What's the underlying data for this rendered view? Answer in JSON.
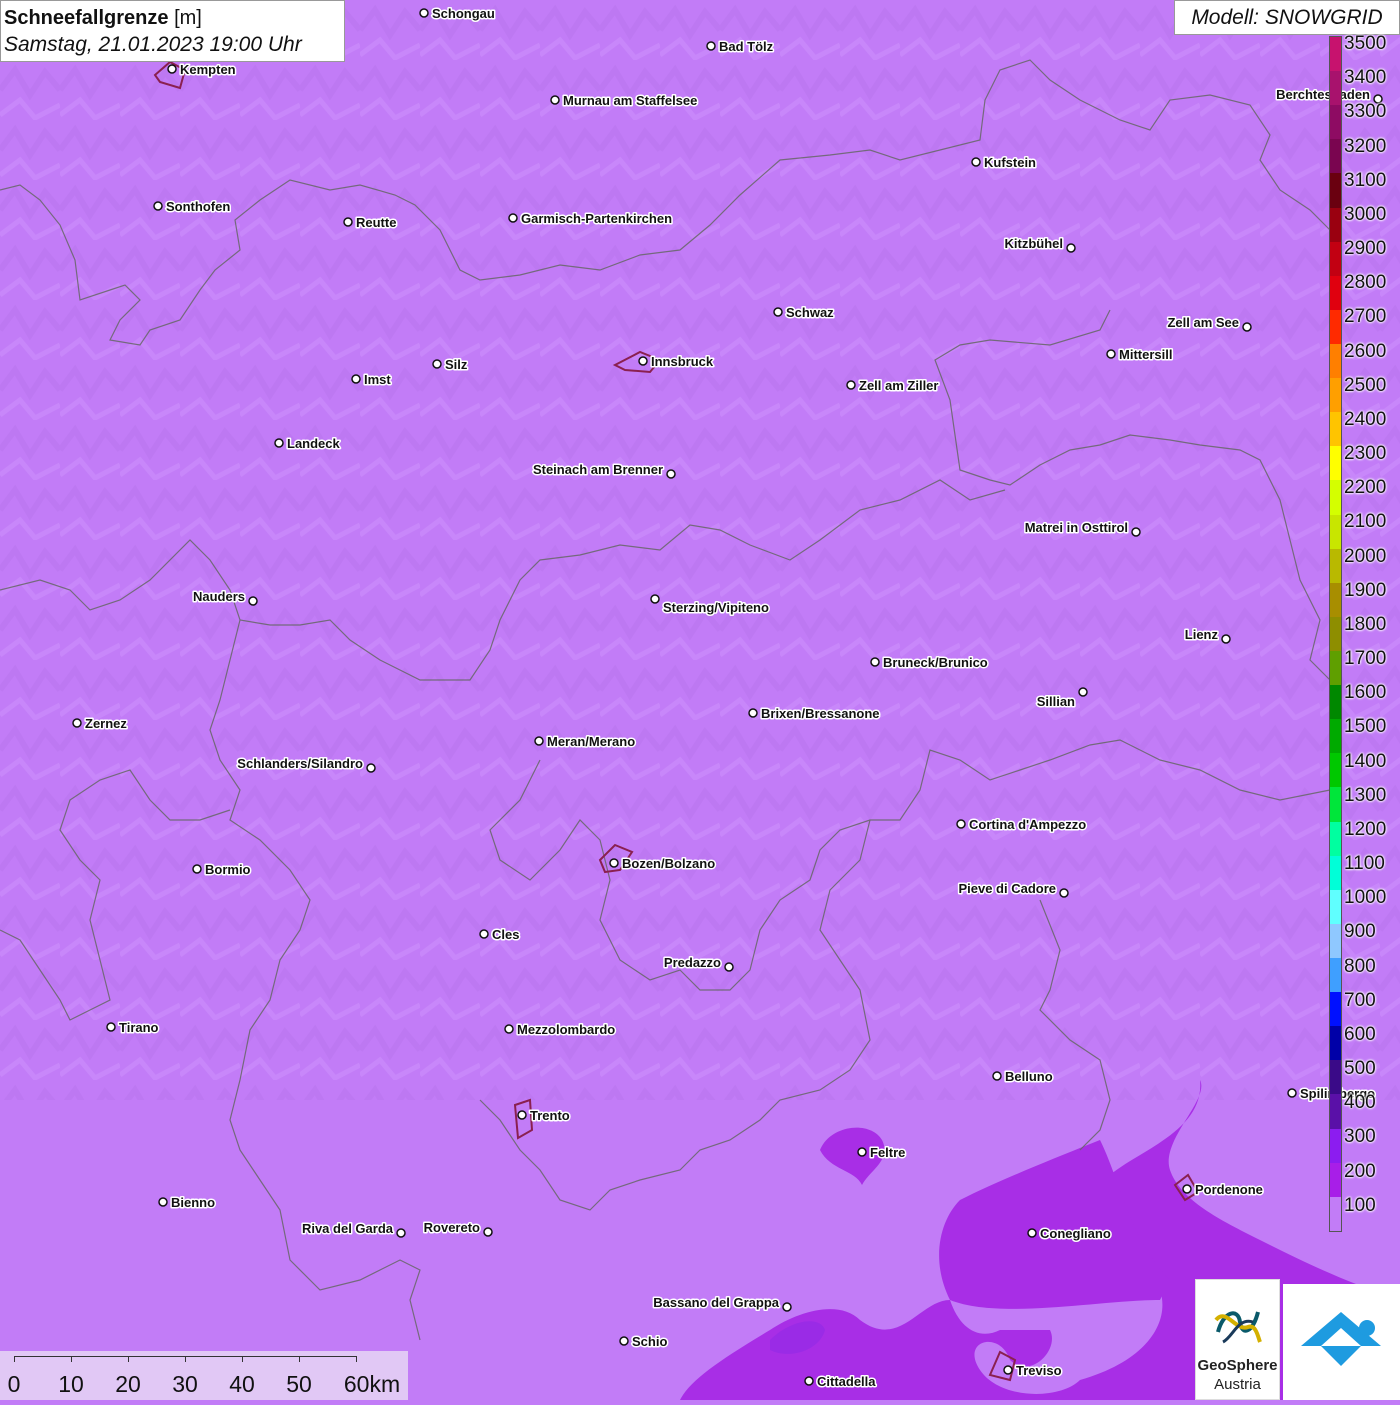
{
  "title": {
    "variable": "Schneefallgrenze",
    "unit": "[m]",
    "datetime": "Samstag, 21.01.2023 19:00 Uhr"
  },
  "model": "Modell: SNOWGRID",
  "legend": {
    "labels": [
      "3500",
      "3400",
      "3300",
      "3200",
      "3100",
      "3000",
      "2900",
      "2800",
      "2700",
      "2600",
      "2500",
      "2400",
      "2300",
      "2200",
      "2100",
      "2000",
      "1900",
      "1800",
      "1700",
      "1600",
      "1500",
      "1400",
      "1300",
      "1200",
      "1100",
      "1000",
      "900",
      "800",
      "700",
      "600",
      "500",
      "400",
      "300",
      "200",
      "100"
    ],
    "colors": [
      "#c7126e",
      "#a8126d",
      "#8e0b63",
      "#7a0550",
      "#6a0010",
      "#9a0010",
      "#c20012",
      "#e0000f",
      "#ff2a00",
      "#ff7f00",
      "#ff9f00",
      "#ffc400",
      "#ffff00",
      "#d4ff00",
      "#c8e600",
      "#b9b900",
      "#a88e00",
      "#8e8e00",
      "#5f9f00",
      "#008800",
      "#00aa00",
      "#00c800",
      "#00e63a",
      "#00ffa0",
      "#00ffd8",
      "#60ffff",
      "#8fc8ff",
      "#3f9fff",
      "#0010ff",
      "#0000a8",
      "#3a0a88",
      "#5a10a8",
      "#8c1cf0",
      "#a81ee8",
      "#c27cf7"
    ]
  },
  "cities": [
    {
      "name": "Schongau"
    },
    {
      "name": "Bad Tölz"
    },
    {
      "name": "Kempten"
    },
    {
      "name": "Murnau am Staffelsee"
    },
    {
      "name": "Berchtesgaden"
    },
    {
      "name": "Kufstein"
    },
    {
      "name": "Sonthofen"
    },
    {
      "name": "Reutte"
    },
    {
      "name": "Garmisch-Partenkirchen"
    },
    {
      "name": "Kitzbühel"
    },
    {
      "name": "Schwaz"
    },
    {
      "name": "Zell am See"
    },
    {
      "name": "Innsbruck"
    },
    {
      "name": "Mittersill"
    },
    {
      "name": "Imst"
    },
    {
      "name": "Silz"
    },
    {
      "name": "Zell am Ziller"
    },
    {
      "name": "Landeck"
    },
    {
      "name": "Steinach am Brenner"
    },
    {
      "name": "Matrei in Osttirol"
    },
    {
      "name": "Nauders"
    },
    {
      "name": "Sterzing/Vipiteno"
    },
    {
      "name": "Lienz"
    },
    {
      "name": "Bruneck/Brunico"
    },
    {
      "name": "Sillian"
    },
    {
      "name": "Brixen/Bressanone"
    },
    {
      "name": "Zernez"
    },
    {
      "name": "Meran/Merano"
    },
    {
      "name": "Schlanders/Silandro"
    },
    {
      "name": "Cortina d'Ampezzo"
    },
    {
      "name": "Bozen/Bolzano"
    },
    {
      "name": "Bormio"
    },
    {
      "name": "Pieve di Cadore"
    },
    {
      "name": "Cles"
    },
    {
      "name": "Predazzo"
    },
    {
      "name": "Tirano"
    },
    {
      "name": "Mezzolombardo"
    },
    {
      "name": "Belluno"
    },
    {
      "name": "Spilimbergo"
    },
    {
      "name": "Trento"
    },
    {
      "name": "Feltre"
    },
    {
      "name": "Pordenone"
    },
    {
      "name": "Bienno"
    },
    {
      "name": "Riva del Garda"
    },
    {
      "name": "Rovereto"
    },
    {
      "name": "Conegliano"
    },
    {
      "name": "Bassano del Grappa"
    },
    {
      "name": "Schio"
    },
    {
      "name": "Treviso"
    },
    {
      "name": "Cittadella"
    }
  ],
  "scale": {
    "ticks": [
      "0",
      "10",
      "20",
      "30",
      "40",
      "50",
      "60km"
    ]
  },
  "logos": {
    "geosphere_line1": "GeoSphere",
    "geosphere_line2": "Austria"
  }
}
